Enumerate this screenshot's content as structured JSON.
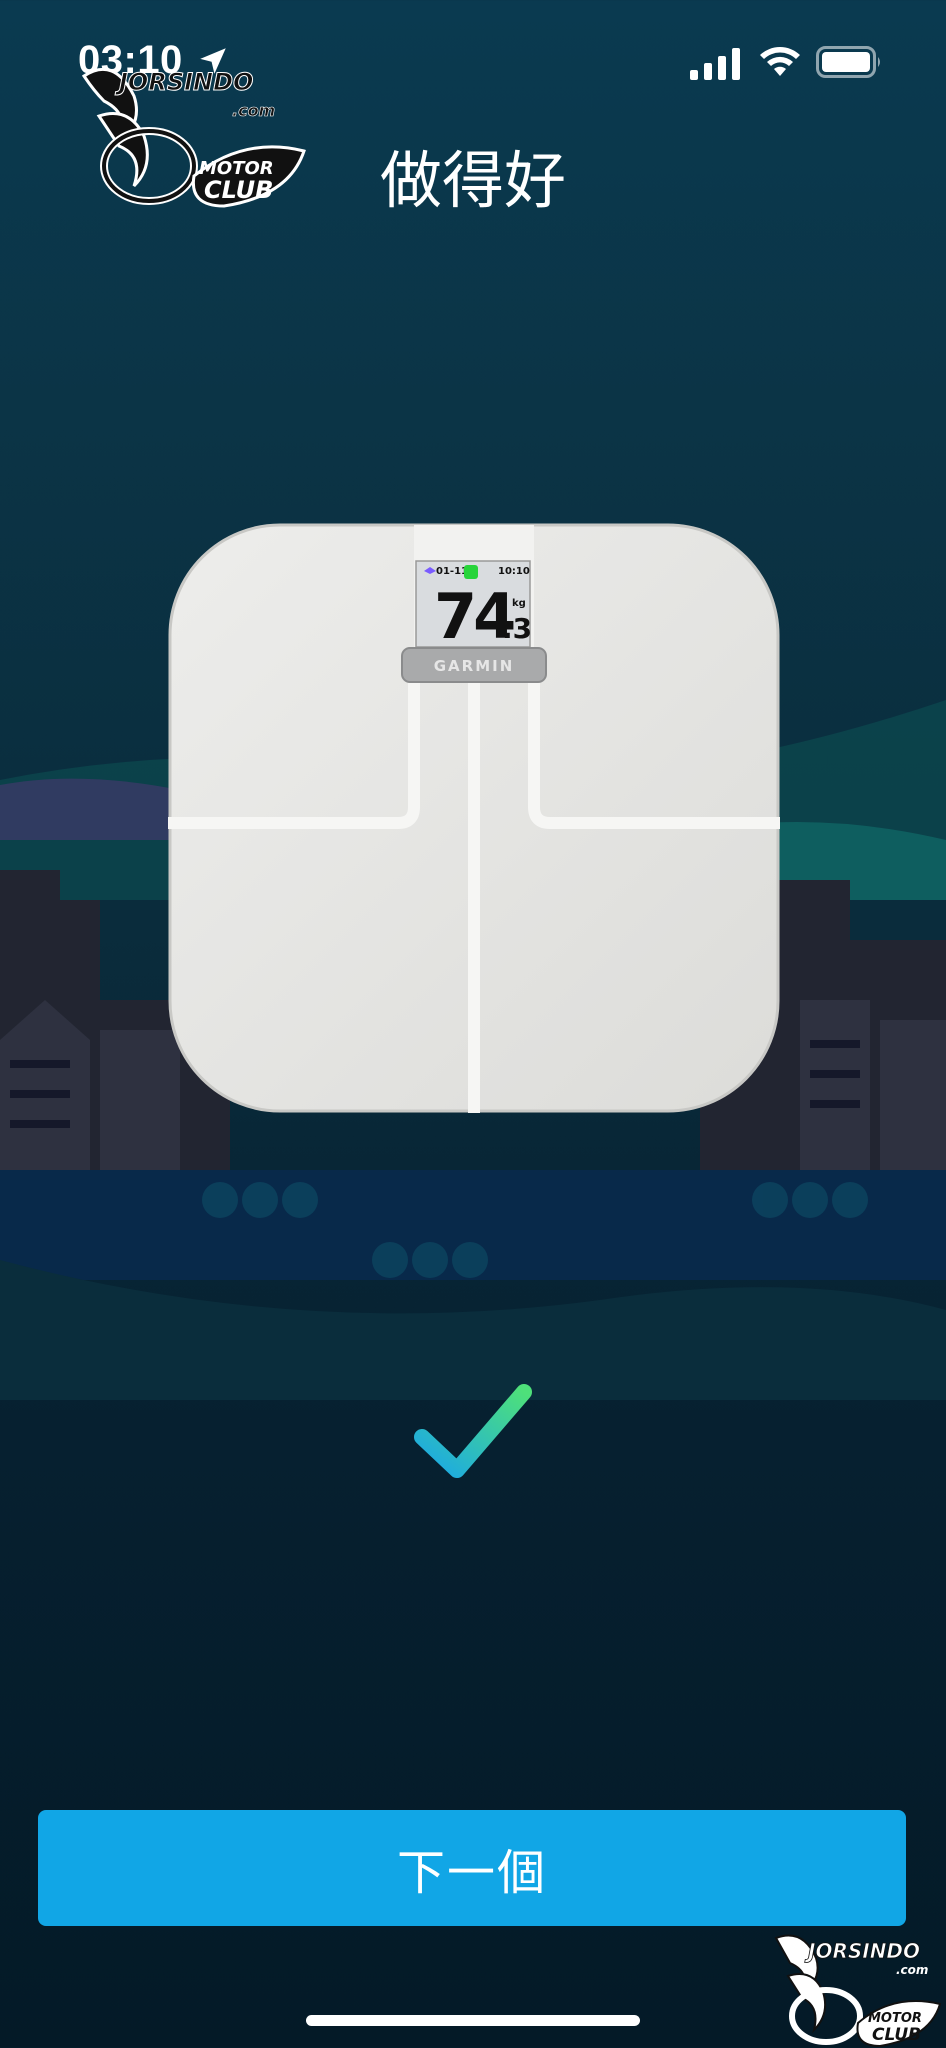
{
  "status_bar": {
    "time": "03:10"
  },
  "header": {
    "title": "做得好"
  },
  "watermark": {
    "name": "JORSINDO",
    "domain": ".com",
    "line1": "MOTOR",
    "line2": "CLUB"
  },
  "scale_display": {
    "date": "01-11",
    "clock": "10:10",
    "weight_int": "74",
    "weight_dec": ".3",
    "unit": "kg",
    "brand": "GARMIN"
  },
  "footer": {
    "next_label": "下一個"
  },
  "colors": {
    "accent": "#11a6e6",
    "check_start": "#1aa7e8",
    "check_end": "#4ee07a"
  }
}
